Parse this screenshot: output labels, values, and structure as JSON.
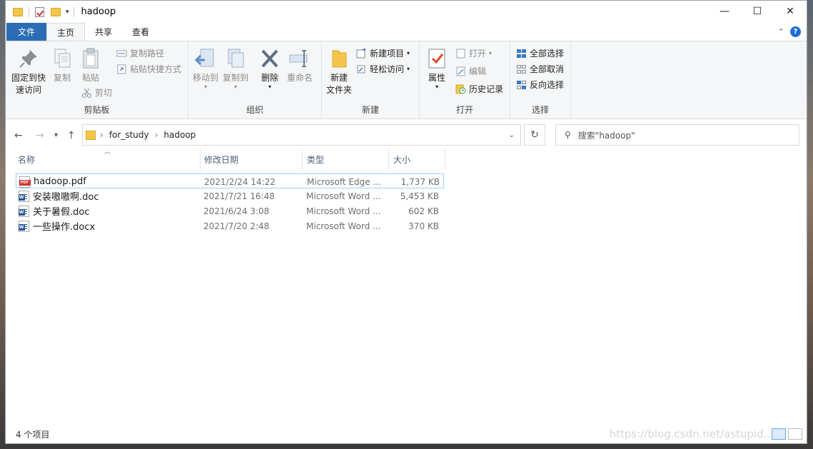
{
  "window": {
    "title": "hadoop"
  },
  "controls": {
    "minimize": "—",
    "maximize": "☐",
    "close": "✕"
  },
  "tabs": [
    {
      "label": "文件"
    },
    {
      "label": "主页"
    },
    {
      "label": "共享"
    },
    {
      "label": "查看"
    }
  ],
  "ribbon": {
    "clipboard": {
      "pin": "固定到快",
      "pin2": "速访问",
      "copy": "复制",
      "paste": "粘贴",
      "copy_path": "复制路径",
      "paste_shortcut": "粘贴快捷方式",
      "cut": "剪切",
      "label": "剪贴板"
    },
    "organize": {
      "move_to": "移动到",
      "copy_to": "复制到",
      "delete": "删除",
      "rename": "重命名",
      "label": "组织"
    },
    "new": {
      "new_folder": "新建",
      "new_folder2": "文件夹",
      "new_item": "新建项目",
      "easy_access": "轻松访问",
      "label": "新建"
    },
    "open": {
      "properties": "属性",
      "open": "打开",
      "edit": "编辑",
      "history": "历史记录",
      "label": "打开"
    },
    "select": {
      "select_all": "全部选择",
      "select_none": "全部取消",
      "invert": "反向选择",
      "label": "选择"
    }
  },
  "address": {
    "crumbs": [
      "for_study",
      "hadoop"
    ],
    "search_placeholder": "搜索\"hadoop\""
  },
  "columns": {
    "name": "名称",
    "date": "修改日期",
    "type": "类型",
    "size": "大小"
  },
  "files": [
    {
      "name": "hadoop.pdf",
      "date": "2021/2/24 14:22",
      "type": "Microsoft Edge ...",
      "size": "1,737 KB",
      "icon": "pdf-file-icon"
    },
    {
      "name": "安装嗷嗷啊.doc",
      "date": "2021/7/21 16:48",
      "type": "Microsoft Word ...",
      "size": "5,453 KB",
      "icon": "word-file-icon"
    },
    {
      "name": "关于暑假.doc",
      "date": "2021/6/24 3:08",
      "type": "Microsoft Word ...",
      "size": "602 KB",
      "icon": "word-file-icon"
    },
    {
      "name": "一些操作.docx",
      "date": "2021/7/20 2:48",
      "type": "Microsoft Word ...",
      "size": "370 KB",
      "icon": "word-file-icon"
    }
  ],
  "status": {
    "count": "4 个项目"
  },
  "watermark": "https://blog.csdn.net/astupid..."
}
